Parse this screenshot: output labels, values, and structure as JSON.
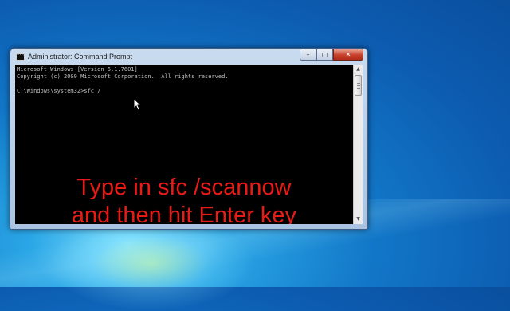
{
  "window": {
    "title": "Administrator: Command Prompt",
    "buttons": {
      "minimize": "–",
      "maximize": "□",
      "close": "✕"
    }
  },
  "console": {
    "lines": [
      "Microsoft Windows [Version 6.1.7601]",
      "Copyright (c) 2009 Microsoft Corporation.  All rights reserved.",
      "",
      "C:\\Windows\\system32>sfc /"
    ]
  },
  "overlay": {
    "line1": "Type in sfc /scannow",
    "line2": "and then hit Enter key",
    "color": "#e81b16"
  },
  "scrollbar": {
    "up": "▲",
    "down": "▼"
  },
  "icons": {
    "app": "cmd-icon",
    "cursor": "mouse-pointer-icon"
  },
  "colors": {
    "console_bg": "#000000",
    "console_text": "#c0c0c0",
    "desktop": "#1277c8"
  }
}
